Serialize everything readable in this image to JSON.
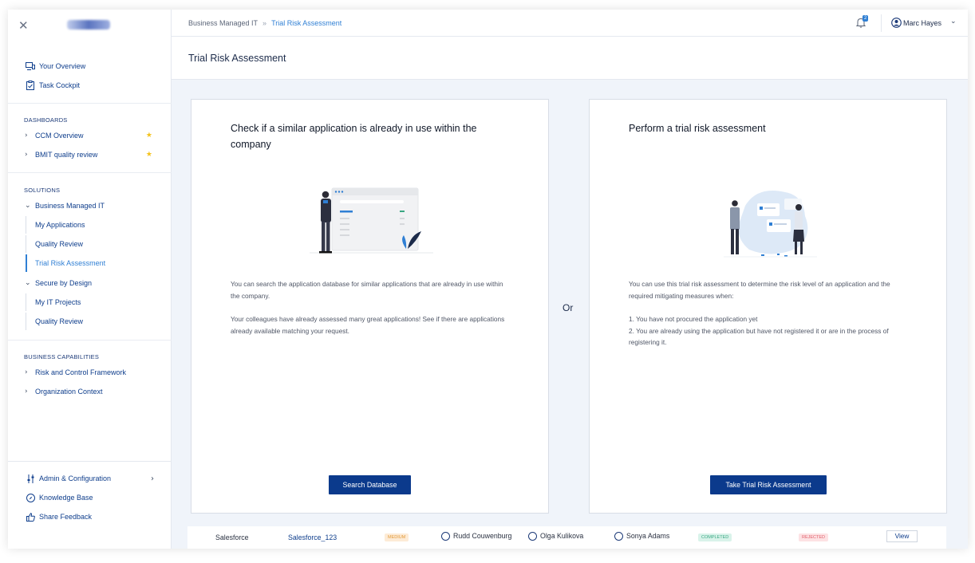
{
  "sidebar": {
    "top_items": [
      {
        "label": "Your Overview",
        "icon": "overview-icon"
      },
      {
        "label": "Task Cockpit",
        "icon": "clipboard-icon"
      }
    ],
    "dashboards_heading": "DASHBOARDS",
    "dashboards": [
      {
        "label": "CCM Overview",
        "starred": true
      },
      {
        "label": "BMIT quality review",
        "starred": true
      }
    ],
    "solutions_heading": "SOLUTIONS",
    "business_managed_it": "Business Managed IT",
    "bmit_sub": [
      "My Applications",
      "Quality Review",
      "Trial Risk Assessment"
    ],
    "secure_by_design": "Secure by Design",
    "sbd_sub": [
      "My IT Projects",
      "Quality Review"
    ],
    "capabilities_heading": "BUSINESS CAPABILITIES",
    "capabilities": [
      "Risk and Control Framework",
      "Organization Context"
    ],
    "bottom": [
      {
        "label": "Admin & Configuration",
        "icon": "sliders-icon"
      },
      {
        "label": "Knowledge Base",
        "icon": "compass-icon"
      },
      {
        "label": "Share Feedback",
        "icon": "thumbs-up-icon"
      }
    ]
  },
  "topbar": {
    "breadcrumb_parent": "Business Managed IT",
    "breadcrumb_separator": "»",
    "breadcrumb_current": "Trial Risk Assessment",
    "notification_count": "2",
    "user_name": "Marc Hayes"
  },
  "page_title": "Trial Risk Assessment",
  "left_card": {
    "title": "Check if a similar application is already in use within the company",
    "paragraphs": [
      "You can search the application database for similar applications that are already in use within the company.",
      "Your colleagues have already assessed many great applications! See if there are applications already available matching your request."
    ],
    "button": "Search Database"
  },
  "or_label": "Or",
  "right_card": {
    "title": "Perform a trial risk assessment",
    "intro": "You can use this trial risk assessment to determine the risk level of an application and the required mitigating measures when:",
    "items": [
      "1. You have not procured the application yet",
      "2. You are already using the application but have not registered it or are in the process of registering it."
    ],
    "button": "Take Trial Risk Assessment"
  },
  "background_row": {
    "app": "Salesforce",
    "id": "Salesforce_123",
    "risk": "MEDIUM",
    "user1": "Rudd Couwenburg",
    "user2": "Olga Kulikova",
    "user3": "Sonya Adams",
    "status1": "COMPLETED",
    "status2": "REJECTED",
    "action": "View"
  },
  "colors": {
    "primary": "#0b3a8c",
    "accent": "#2f7fd4",
    "star": "#f4c21b"
  }
}
